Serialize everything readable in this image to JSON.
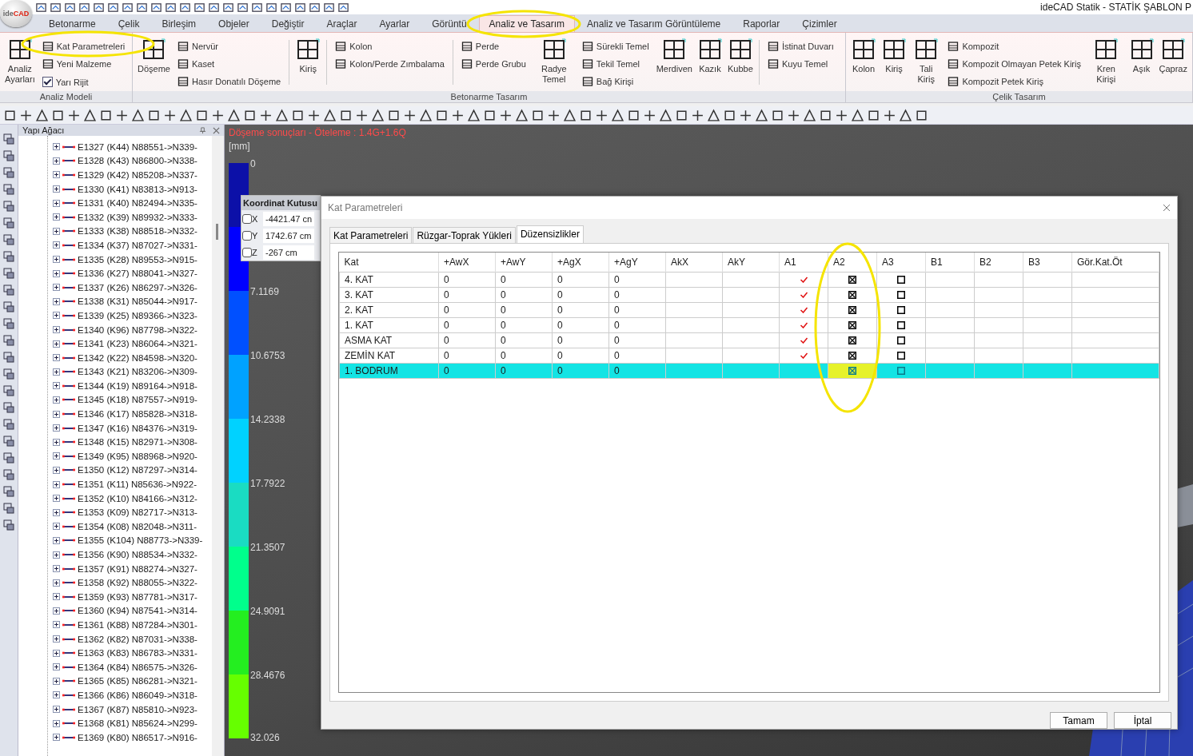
{
  "app": {
    "logo_prefix": "ide",
    "logo_accent": "CAD",
    "title": "ideCAD Statik - STATİK ŞABLON P"
  },
  "ribbon_tabs": [
    {
      "label": "Betonarme",
      "selected": false
    },
    {
      "label": "Çelik",
      "selected": false
    },
    {
      "label": "Birleşim",
      "selected": false
    },
    {
      "label": "Objeler",
      "selected": false
    },
    {
      "label": "Değiştir",
      "selected": false
    },
    {
      "label": "Araçlar",
      "selected": false
    },
    {
      "label": "Ayarlar",
      "selected": false
    },
    {
      "label": "Görüntü",
      "selected": false
    },
    {
      "label": "Analiz ve Tasarım",
      "selected": true
    },
    {
      "label": "Analiz ve Tasarım Görüntüleme",
      "selected": false
    },
    {
      "label": "Raporlar",
      "selected": false
    },
    {
      "label": "Çizimler",
      "selected": false
    }
  ],
  "ribbon_groups": [
    {
      "label": "Analiz Modeli",
      "items": [
        {
          "kind": "large",
          "label": "Analiz Ayarları"
        },
        {
          "kind": "column",
          "items": [
            {
              "kind": "button",
              "label": "Kat Parametreleri"
            },
            {
              "kind": "button",
              "label": "Yeni Malzeme"
            },
            {
              "kind": "checkbox",
              "label": "Yarı Rijit",
              "checked": true
            }
          ]
        }
      ]
    },
    {
      "label": "Betonarme Tasarım",
      "items": [
        {
          "kind": "large",
          "label": "Döşeme"
        },
        {
          "kind": "column",
          "items": [
            {
              "kind": "button",
              "label": "Nervür"
            },
            {
              "kind": "button",
              "label": "Kaset"
            },
            {
              "kind": "button",
              "label": "Hasır Donatılı Döşeme"
            }
          ]
        },
        {
          "kind": "separator"
        },
        {
          "kind": "large",
          "label": "Kiriş"
        },
        {
          "kind": "separator"
        },
        {
          "kind": "column",
          "items": [
            {
              "kind": "button",
              "label": "Kolon"
            },
            {
              "kind": "button",
              "label": "Kolon/Perde Zımbalama"
            }
          ]
        },
        {
          "kind": "separator"
        },
        {
          "kind": "column",
          "items": [
            {
              "kind": "button",
              "label": "Perde"
            },
            {
              "kind": "button",
              "label": "Perde Grubu"
            }
          ]
        },
        {
          "kind": "large",
          "label": "Radye Temel"
        },
        {
          "kind": "column",
          "items": [
            {
              "kind": "button",
              "label": "Sürekli Temel"
            },
            {
              "kind": "button",
              "label": "Tekil Temel"
            },
            {
              "kind": "button",
              "label": "Bağ Kirişi"
            }
          ]
        },
        {
          "kind": "large",
          "label": "Merdiven"
        },
        {
          "kind": "large",
          "label": "Kazık"
        },
        {
          "kind": "large",
          "label": "Kubbe"
        },
        {
          "kind": "separator"
        },
        {
          "kind": "column",
          "items": [
            {
              "kind": "button",
              "label": "İstinat Duvarı"
            },
            {
              "kind": "button",
              "label": "Kuyu Temel"
            }
          ]
        }
      ]
    },
    {
      "label": "Çelik Tasarım",
      "items": [
        {
          "kind": "large",
          "label": "Kolon"
        },
        {
          "kind": "large",
          "label": "Kiriş"
        },
        {
          "kind": "large",
          "label": "Tali Kiriş"
        },
        {
          "kind": "column",
          "items": [
            {
              "kind": "button",
              "label": "Kompozit"
            },
            {
              "kind": "button",
              "label": "Kompozit Olmayan Petek Kiriş"
            },
            {
              "kind": "button",
              "label": "Kompozit Petek Kiriş"
            }
          ]
        },
        {
          "kind": "large",
          "label": "Kren Kirişi"
        },
        {
          "kind": "large",
          "label": "Aşık"
        },
        {
          "kind": "large",
          "label": "Çapraz"
        }
      ]
    }
  ],
  "tree": {
    "title": "Yapı Ağacı",
    "items": [
      {
        "label": "E1327 (K44) N88551->N339-",
        "expanded": false
      },
      {
        "label": "E1328 (K43) N86800->N338-",
        "expanded": false
      },
      {
        "label": "E1329 (K42) N85208->N337-",
        "expanded": false
      },
      {
        "label": "E1330 (K41) N83813->N913-",
        "expanded": false
      },
      {
        "label": "E1331 (K40) N82494->N335-",
        "expanded": false
      },
      {
        "label": "E1332 (K39) N89932->N333-",
        "expanded": false
      },
      {
        "label": "E1333 (K38) N88518->N332-",
        "expanded": false
      },
      {
        "label": "E1334 (K37) N87027->N331-",
        "expanded": false
      },
      {
        "label": "E1335 (K28) N89553->N915-",
        "expanded": false
      },
      {
        "label": "E1336 (K27) N88041->N327-",
        "expanded": false
      },
      {
        "label": "E1337 (K26) N86297->N326-",
        "expanded": false
      },
      {
        "label": "E1338 (K31) N85044->N917-",
        "expanded": false
      },
      {
        "label": "E1339 (K25) N89366->N323-",
        "expanded": false
      },
      {
        "label": "E1340 (K96) N87798->N322-",
        "expanded": false
      },
      {
        "label": "E1341 (K23) N86064->N321-",
        "expanded": false
      },
      {
        "label": "E1342 (K22) N84598->N320-",
        "expanded": false
      },
      {
        "label": "E1343 (K21) N83206->N309-",
        "expanded": false
      },
      {
        "label": "E1344 (K19) N89164->N918-",
        "expanded": false
      },
      {
        "label": "E1345 (K18) N87557->N919-",
        "expanded": false
      },
      {
        "label": "E1346 (K17) N85828->N318-",
        "expanded": false
      },
      {
        "label": "E1347 (K16) N84376->N319-",
        "expanded": false
      },
      {
        "label": "E1348 (K15) N82971->N308-",
        "expanded": false
      },
      {
        "label": "E1349 (K95) N88968->N920-",
        "expanded": false
      },
      {
        "label": "E1350 (K12) N87297->N314-",
        "expanded": false
      },
      {
        "label": "E1351 (K11) N85636->N922-",
        "expanded": false
      },
      {
        "label": "E1352 (K10) N84166->N312-",
        "expanded": false
      },
      {
        "label": "E1353 (K09) N82717->N313-",
        "expanded": false
      },
      {
        "label": "E1354 (K08) N82048->N311-",
        "expanded": false
      },
      {
        "label": "E1355 (K104) N88773->N339-",
        "expanded": false
      },
      {
        "label": "E1356 (K90) N88534->N332-",
        "expanded": false
      },
      {
        "label": "E1357 (K91) N88274->N327-",
        "expanded": false
      },
      {
        "label": "E1358 (K92) N88055->N322-",
        "expanded": false
      },
      {
        "label": "E1359 (K93) N87781->N317-",
        "expanded": false
      },
      {
        "label": "E1360 (K94) N87541->N314-",
        "expanded": false
      },
      {
        "label": "E1361 (K88) N87284->N301-",
        "expanded": false
      },
      {
        "label": "E1362 (K82) N87031->N338-",
        "expanded": false
      },
      {
        "label": "E1363 (K83) N86783->N331-",
        "expanded": false
      },
      {
        "label": "E1364 (K84) N86575->N326-",
        "expanded": false
      },
      {
        "label": "E1365 (K85) N86281->N321-",
        "expanded": false
      },
      {
        "label": "E1366 (K86) N86049->N318-",
        "expanded": false
      },
      {
        "label": "E1367 (K87) N85810->N923-",
        "expanded": false
      },
      {
        "label": "E1368 (K81) N85624->N299-",
        "expanded": false
      },
      {
        "label": "E1369 (K80) N86517->N916-",
        "expanded": false
      }
    ]
  },
  "viewport": {
    "caption": "Döşeme sonuçları - Öteleme : 1.4G+1.6Q",
    "legend": {
      "unit": "[mm]",
      "end_label": "32.026",
      "bands": [
        {
          "color": "#0c10a8",
          "label": "0"
        },
        {
          "color": "#0000ff"
        },
        {
          "color": "#0050ff",
          "label": "7.1169"
        },
        {
          "color": "#00a2ff",
          "label": "10.6753"
        },
        {
          "color": "#00d2ff",
          "label": "14.2338"
        },
        {
          "color": "#1adcc2",
          "label": "17.7922"
        },
        {
          "color": "#00ff8c",
          "label": "21.3507"
        },
        {
          "color": "#24ee20",
          "label": "24.9091"
        },
        {
          "color": "#66ff00",
          "label": "28.4676"
        }
      ]
    }
  },
  "coordinate_box": {
    "title": "Koordinat Kutusu",
    "rows": [
      {
        "axis": "X",
        "checked": false,
        "value": "-4421.47 cn"
      },
      {
        "axis": "Y",
        "checked": false,
        "value": "1742.67 cm"
      },
      {
        "axis": "Z",
        "checked": false,
        "value": "-267 cm"
      }
    ]
  },
  "dialog": {
    "title": "Kat Parametreleri",
    "tabs": [
      {
        "label": "Kat Parametreleri",
        "selected": false
      },
      {
        "label": "Rüzgar-Toprak Yükleri",
        "selected": false
      },
      {
        "label": "Düzensizlikler",
        "selected": true
      }
    ],
    "columns": [
      "Kat",
      "+AwX",
      "+AwY",
      "+AgX",
      "+AgY",
      "AkX",
      "AkY",
      "A1",
      "A2",
      "A3",
      "B1",
      "B2",
      "B3",
      "Gör.Kat.Öt"
    ],
    "rows": [
      {
        "kat": "4. KAT",
        "awx": "0",
        "awy": "0",
        "agx": "0",
        "agy": "0",
        "a1": true,
        "a2": true,
        "a3": false,
        "a2_focused": false,
        "selected": false
      },
      {
        "kat": "3. KAT",
        "awx": "0",
        "awy": "0",
        "agx": "0",
        "agy": "0",
        "a1": true,
        "a2": true,
        "a3": false,
        "a2_focused": false,
        "selected": false
      },
      {
        "kat": "2. KAT",
        "awx": "0",
        "awy": "0",
        "agx": "0",
        "agy": "0",
        "a1": true,
        "a2": true,
        "a3": false,
        "a2_focused": false,
        "selected": false
      },
      {
        "kat": "1. KAT",
        "awx": "0",
        "awy": "0",
        "agx": "0",
        "agy": "0",
        "a1": true,
        "a2": true,
        "a3": false,
        "a2_focused": false,
        "selected": false
      },
      {
        "kat": "ASMA KAT",
        "awx": "0",
        "awy": "0",
        "agx": "0",
        "agy": "0",
        "a1": true,
        "a2": true,
        "a3": false,
        "a2_focused": false,
        "selected": false
      },
      {
        "kat": "ZEMİN KAT",
        "awx": "0",
        "awy": "0",
        "agx": "0",
        "agy": "0",
        "a1": true,
        "a2": true,
        "a3": false,
        "a2_focused": false,
        "selected": false
      },
      {
        "kat": "1. BODRUM",
        "awx": "0",
        "awy": "0",
        "agx": "0",
        "agy": "0",
        "a1": false,
        "a2": true,
        "a3": false,
        "a2_focused": true,
        "selected": true
      }
    ],
    "buttons": [
      "Tamam",
      "İptal"
    ]
  }
}
